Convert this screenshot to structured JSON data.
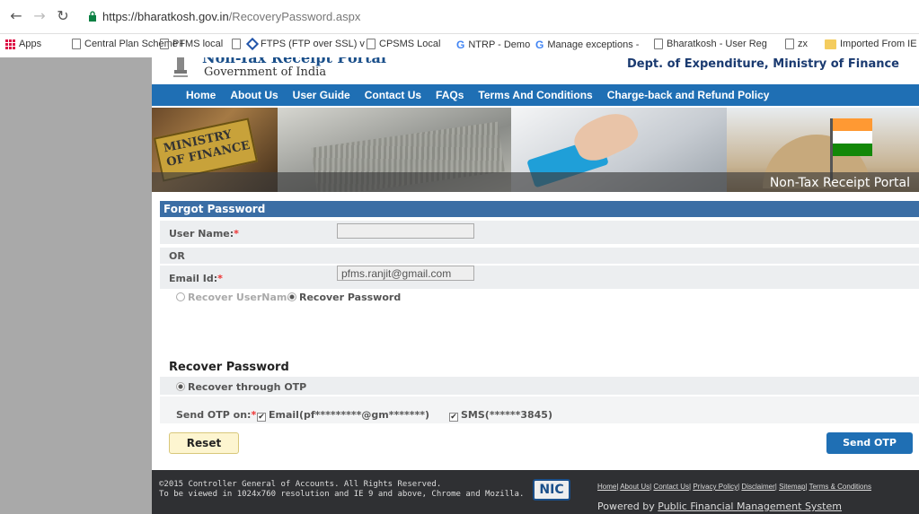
{
  "browser": {
    "url_host": "https://bharatkosh.gov.in",
    "url_path": "/RecoveryPassword.aspx",
    "bookmarks": [
      {
        "label": "Apps",
        "icon": "apps-grid-icon"
      },
      {
        "label": "Central Plan Scheme I",
        "icon": "page-icon"
      },
      {
        "label": "PFMS local",
        "icon": "page-icon"
      },
      {
        "label": "",
        "icon": "page-icon"
      },
      {
        "label": "FTPS (FTP over SSL) v",
        "icon": "diamond-icon"
      },
      {
        "label": "CPSMS Local",
        "icon": "page-icon"
      },
      {
        "label": "NTRP - Demo",
        "icon": "google-icon"
      },
      {
        "label": "Manage exceptions -",
        "icon": "google-icon"
      },
      {
        "label": "Bharatkosh - User Reg",
        "icon": "page-icon"
      },
      {
        "label": "zx",
        "icon": "page-icon"
      },
      {
        "label": "Imported From IE",
        "icon": "folder-icon"
      }
    ]
  },
  "header": {
    "portal_name": "Non-Tax Receipt Portal",
    "government": "Government of India",
    "department": "Dept. of Expenditure, Ministry of Finance"
  },
  "menu": [
    "Home",
    "About Us",
    "User Guide",
    "Contact Us",
    "FAQs",
    "Terms And Conditions",
    "Charge-back and Refund Policy"
  ],
  "banner": {
    "title": "Non-Tax Receipt Portal",
    "ministry_sign": "MINISTRY OF FINANCE"
  },
  "form": {
    "panel_title": "Forgot Password",
    "username_label": "User Name:",
    "username_value": "",
    "or_label": "OR",
    "email_label": "Email Id:",
    "email_value": "pfms.ranjit@gmail.com",
    "recover_username": "Recover UserName",
    "recover_password": "Recover Password",
    "section_title": "Recover Password",
    "recover_otp": "Recover through OTP",
    "send_otp_label": "Send OTP on:",
    "otp_email": "Email(pf*********@gm*******)",
    "otp_sms": "SMS(******3845)",
    "reset_label": "Reset",
    "send_otp_button": "Send OTP",
    "required_mark": "*"
  },
  "footer": {
    "copyright": "©2015 Controller General of Accounts. All Rights Reserved.",
    "resolution_note": "To be viewed in 1024x760 resolution and IE 9 and above, Chrome and Mozilla.",
    "nic_logo": "NIC",
    "links": [
      "Home",
      "About Us",
      "Contact Us",
      "Privacy Policy",
      "Disclaimer",
      "Sitemap",
      "Terms & Conditions"
    ],
    "powered_prefix": "Powered by",
    "powered_name": "Public Financial Management System"
  }
}
